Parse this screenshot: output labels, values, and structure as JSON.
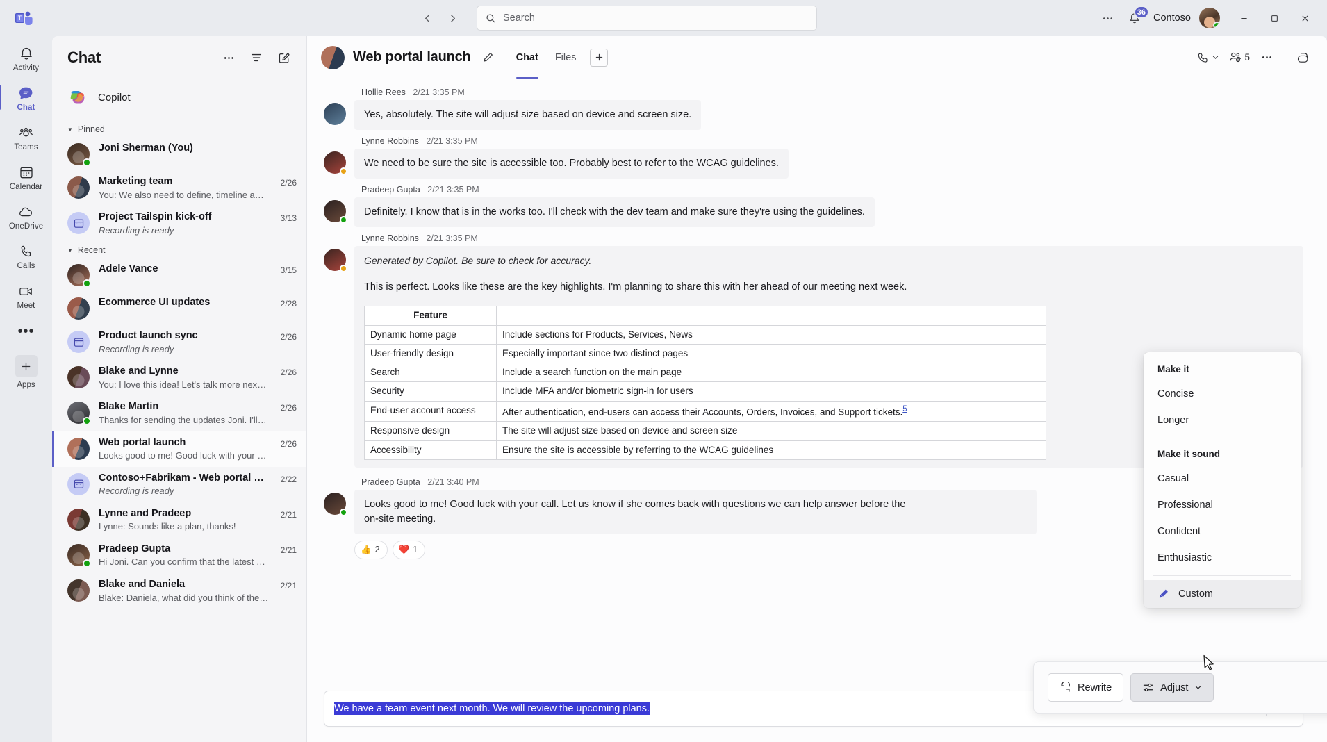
{
  "titlebar": {
    "app_logo": "teams-logo",
    "back_label": "Back",
    "forward_label": "Forward",
    "search_placeholder": "Search",
    "more_label": "…",
    "notifications_badge": "36",
    "tenant": "Contoso",
    "minimize": "—",
    "maximize": "▢",
    "close": "✕"
  },
  "rail": {
    "items": [
      {
        "label": "Activity",
        "icon": "bell-icon",
        "active": false
      },
      {
        "label": "Chat",
        "icon": "chat-bubble-icon",
        "active": true
      },
      {
        "label": "Teams",
        "icon": "people-icon",
        "active": false
      },
      {
        "label": "Calendar",
        "icon": "calendar-icon",
        "active": false
      },
      {
        "label": "OneDrive",
        "icon": "cloud-icon",
        "active": false
      },
      {
        "label": "Calls",
        "icon": "phone-icon",
        "active": false
      },
      {
        "label": "Meet",
        "icon": "video-camera-icon",
        "active": false
      }
    ],
    "more": "•••",
    "apps_label": "Apps",
    "apps_icon": "plus-icon"
  },
  "chatlist": {
    "title": "Chat",
    "more_icon": "more-horizontal-icon",
    "filter_icon": "filter-icon",
    "compose_icon": "compose-icon",
    "copilot": {
      "name": "Copilot",
      "icon": "copilot-icon"
    },
    "groups": [
      {
        "name": "Pinned",
        "items": [
          {
            "name": "Joni Sherman (You)",
            "preview": "",
            "time": "",
            "avatar": "photo",
            "presence": "online"
          },
          {
            "name": "Marketing team",
            "preview": "You: We also need to define, timeline and miles…",
            "time": "2/26",
            "avatar": "group",
            "presence": ""
          },
          {
            "name": "Project Tailspin kick-off",
            "preview": "Recording is ready",
            "time": "3/13",
            "avatar": "meeting",
            "presence": "",
            "italic": true
          }
        ]
      },
      {
        "name": "Recent",
        "items": [
          {
            "name": "Adele Vance",
            "preview": "",
            "time": "3/15",
            "avatar": "photo",
            "presence": "online"
          },
          {
            "name": "Ecommerce UI updates",
            "preview": "",
            "time": "2/28",
            "avatar": "group",
            "presence": ""
          },
          {
            "name": "Product launch sync",
            "preview": "Recording is ready",
            "time": "2/26",
            "avatar": "meeting",
            "presence": "",
            "italic": true
          },
          {
            "name": "Blake and Lynne",
            "preview": "You: I love this idea! Let's talk more next week.",
            "time": "2/26",
            "avatar": "group",
            "presence": ""
          },
          {
            "name": "Blake Martin",
            "preview": "Thanks for sending the updates Joni. I'll have s…",
            "time": "2/26",
            "avatar": "photo",
            "presence": "online"
          },
          {
            "name": "Web portal launch",
            "preview": "Looks good to me! Good luck with your call.",
            "time": "2/26",
            "avatar": "group",
            "presence": "",
            "selected": true
          },
          {
            "name": "Contoso+Fabrikam - Web portal ki…",
            "preview": "Recording is ready",
            "time": "2/22",
            "avatar": "meeting",
            "presence": "",
            "italic": true
          },
          {
            "name": "Lynne and Pradeep",
            "preview": "Lynne: Sounds like a plan, thanks!",
            "time": "2/21",
            "avatar": "group",
            "presence": ""
          },
          {
            "name": "Pradeep Gupta",
            "preview": "Hi Joni. Can you confirm that the latest updates…",
            "time": "2/21",
            "avatar": "photo",
            "presence": "online"
          },
          {
            "name": "Blake and Daniela",
            "preview": "Blake: Daniela, what did you think of the new d…",
            "time": "2/21",
            "avatar": "group",
            "presence": ""
          }
        ]
      }
    ]
  },
  "pane": {
    "title": "Web portal launch",
    "edit_icon": "pencil-icon",
    "tabs": [
      {
        "label": "Chat",
        "active": true
      },
      {
        "label": "Files",
        "active": false
      }
    ],
    "add_tab_icon": "plus-icon",
    "call_icon": "phone-icon",
    "call_chevron": "chevron-down-icon",
    "people_icon": "people-add-icon",
    "people_count": "5",
    "more_icon": "more-horizontal-icon",
    "copilot_icon": "copilot-icon"
  },
  "messages": [
    {
      "author": "Hollie Rees",
      "time": "2/21 3:35 PM",
      "text": "Yes, absolutely. The site will adjust size based on device and screen size.",
      "presence": "offline"
    },
    {
      "author": "Lynne Robbins",
      "time": "2/21 3:35 PM",
      "text": "We need to be sure the site is accessible too. Probably best to refer to the WCAG guidelines.",
      "presence": "away"
    },
    {
      "author": "Pradeep Gupta",
      "time": "2/21 3:35 PM",
      "text": "Definitely. I know that is in the works too. I'll check with the dev team and make sure they're using the guidelines.",
      "presence": "online"
    }
  ],
  "copilot_message": {
    "author": "Lynne Robbins",
    "time": "2/21 3:35 PM",
    "ai_note": "Generated by Copilot. Be sure to check for accuracy.",
    "paragraph": "This is perfect. Looks like these are the key highlights. I'm planning to share this with her ahead of our meeting next week.",
    "table": {
      "headers": [
        "Feature",
        ""
      ],
      "rows": [
        [
          "Dynamic home page",
          "Include sections for Products, Services, News"
        ],
        [
          "User-friendly design",
          "Especially important since two distinct pages"
        ],
        [
          "Search",
          "Include a search function on the main page"
        ],
        [
          "Security",
          "Include MFA and/or biometric sign-in for users"
        ],
        [
          "End-user account access",
          "After authentication, end-users can access their Accounts, Orders, Invoices, and Support tickets."
        ],
        [
          "Responsive design",
          "The site will adjust size based on device and screen size"
        ],
        [
          "Accessibility",
          "Ensure the site is accessible by referring to the WCAG guidelines"
        ]
      ],
      "citation": "5"
    }
  },
  "last_message": {
    "author": "Pradeep Gupta",
    "time": "2/21 3:40 PM",
    "text_line1": "Looks good to me! Good luck with your call. Let us know if she comes back with questions we can help answer before the",
    "text_line2": "on-site meeting.",
    "reactions": [
      {
        "emoji": "👍",
        "count": "2"
      },
      {
        "emoji": "❤️",
        "count": "1"
      }
    ]
  },
  "copilot_bar": {
    "rewrite_label": "Rewrite",
    "rewrite_icon": "refresh-icon",
    "adjust_label": "Adjust",
    "adjust_icon": "sliders-icon",
    "adjust_chevron": "chevron-down-icon",
    "close_icon": "close-icon"
  },
  "adjust_menu": {
    "section1_title": "Make it",
    "section1_items": [
      "Concise",
      "Longer"
    ],
    "section2_title": "Make it sound",
    "section2_items": [
      "Casual",
      "Professional",
      "Confident",
      "Enthusiastic"
    ],
    "custom_label": "Custom",
    "custom_icon": "edit-pen-icon"
  },
  "composer": {
    "message_text": "We have a team event next month. We will review the upcoming plans.",
    "icons": [
      {
        "name": "format-icon"
      },
      {
        "name": "emoji-icon"
      },
      {
        "name": "copilot-icon"
      },
      {
        "name": "mention-icon"
      },
      {
        "name": "plus-icon"
      },
      {
        "name": "send-icon"
      }
    ]
  },
  "colors": {
    "accent": "#5b5fc7",
    "selection": "#3b3bd6",
    "online": "#13a10e",
    "away": "#e8a317",
    "rail_bg": "#e9ebef",
    "list_bg": "#f5f5f7",
    "pane_bg": "#fcfcfd"
  }
}
